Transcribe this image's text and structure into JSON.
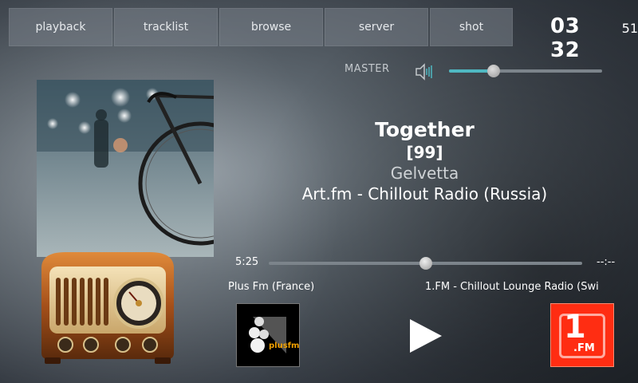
{
  "nav": {
    "tabs": [
      {
        "label": "playback"
      },
      {
        "label": "tracklist"
      },
      {
        "label": "browse"
      },
      {
        "label": "server"
      },
      {
        "label": "shot"
      }
    ]
  },
  "clock": {
    "time": "03 32",
    "seconds": "51"
  },
  "volume": {
    "label": "MASTER",
    "level_percent": 29,
    "icon": "speaker-icon"
  },
  "track": {
    "title": "Together",
    "number": "[99]",
    "artist": "Gelvetta",
    "station": "Art.fm - Chillout Radio (Russia)",
    "elapsed": "5:25",
    "remaining": "--:--",
    "progress_percent": 50
  },
  "stations": {
    "previous": {
      "name": "Plus Fm (France)",
      "logo_text": "plusfm"
    },
    "next": {
      "name": "1.FM - Chillout Lounge Radio (Swi",
      "logo_text": ".FM",
      "logo_digit": "1"
    }
  },
  "colors": {
    "accent": "#4fb8c2",
    "next_logo_bg": "#ff2d12",
    "plusfm_orange": "#f0a000"
  }
}
